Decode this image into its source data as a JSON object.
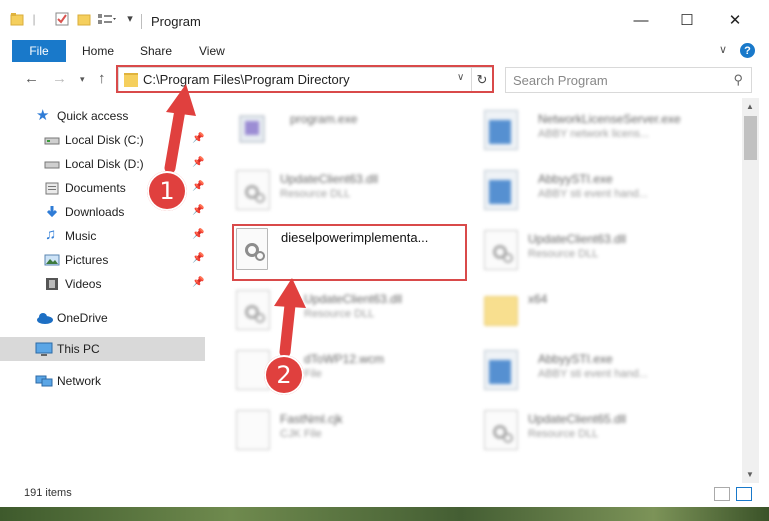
{
  "window": {
    "title": "Program",
    "minimize_icon": "minimize-icon",
    "maximize_icon": "maximize-icon",
    "close_icon": "close-icon"
  },
  "ribbon": {
    "tabs": [
      "File",
      "Home",
      "Share",
      "View"
    ],
    "help": "?"
  },
  "address_bar": {
    "path": "C:\\Program Files\\Program Directory"
  },
  "search": {
    "placeholder": "Search Program"
  },
  "sidebar": {
    "items": [
      {
        "label": "Quick access",
        "icon": "star-icon"
      },
      {
        "label": "Local Disk (C:)",
        "icon": "drive-icon",
        "pinned": true
      },
      {
        "label": "Local Disk (D:)",
        "icon": "drive-icon",
        "pinned": true
      },
      {
        "label": "Documents",
        "icon": "documents-icon",
        "pinned": true
      },
      {
        "label": "Downloads",
        "icon": "download-icon",
        "pinned": true
      },
      {
        "label": "Music",
        "icon": "music-icon",
        "pinned": true
      },
      {
        "label": "Pictures",
        "icon": "pictures-icon",
        "pinned": true
      },
      {
        "label": "Videos",
        "icon": "videos-icon",
        "pinned": true
      },
      {
        "label": "OneDrive",
        "icon": "cloud-icon"
      },
      {
        "label": "This PC",
        "icon": "computer-icon",
        "selected": true
      },
      {
        "label": "Network",
        "icon": "network-icon"
      }
    ]
  },
  "files": {
    "left": [
      {
        "name": "program.exe",
        "type": ""
      },
      {
        "name": "UpdateClient63.dll",
        "type": "Resource DLL"
      },
      {
        "name": "dieselpowerimplementa...",
        "type": ""
      },
      {
        "name": "UpdateClient63.dll",
        "type": "Resource DLL"
      },
      {
        "name": "dToWP12.wcm",
        "type": "File"
      },
      {
        "name": "FastNml.cjk",
        "type": "CJK File"
      }
    ],
    "right": [
      {
        "name": "NetworkLicenseServer.exe",
        "type": "ABBY network licens..."
      },
      {
        "name": "AbbyySTI.exe",
        "type": "ABBY sti event hand..."
      },
      {
        "name": "UpdateClient63.dll",
        "type": "Resource DLL"
      },
      {
        "name": "x64",
        "type": ""
      },
      {
        "name": "AbbyySTI.exe",
        "type": "ABBY sti event hand..."
      },
      {
        "name": "UpdateClient65.dll",
        "type": "Resource DLL"
      }
    ]
  },
  "status": {
    "item_count": "191 items"
  },
  "annotations": {
    "step1": "1",
    "step2": "2",
    "color": "#d94a4a"
  }
}
